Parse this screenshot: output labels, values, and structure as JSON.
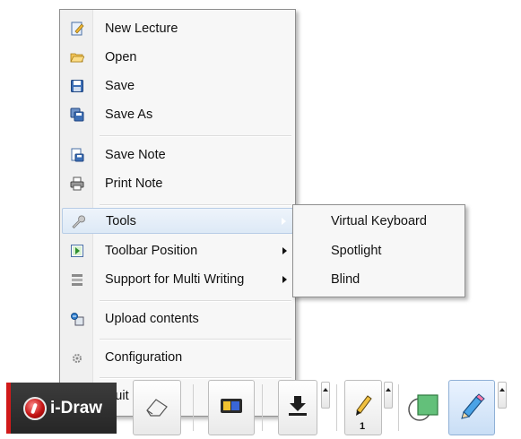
{
  "menu": {
    "items": [
      {
        "label": "New Lecture",
        "icon": "new-lecture-icon"
      },
      {
        "label": "Open",
        "icon": "open-folder-icon"
      },
      {
        "label": "Save",
        "icon": "save-disk-icon"
      },
      {
        "label": "Save As",
        "icon": "save-as-icon"
      },
      {
        "label": "Save Note",
        "icon": "save-note-icon"
      },
      {
        "label": "Print Note",
        "icon": "printer-icon"
      },
      {
        "label": "Tools",
        "icon": "wrench-icon",
        "highlighted": true
      },
      {
        "label": "Toolbar Position",
        "icon": "toolbar-position-icon"
      },
      {
        "label": "Support for Multi Writing",
        "icon": "multi-writing-icon"
      },
      {
        "label": "Upload contents",
        "icon": "upload-icon"
      },
      {
        "label": "Configuration",
        "icon": "gear-icon"
      },
      {
        "label": "Quit i-Pro",
        "icon": "exit-door-icon"
      }
    ]
  },
  "submenu": {
    "items": [
      {
        "label": "Virtual Keyboard"
      },
      {
        "label": "Spotlight"
      },
      {
        "label": "Blind"
      }
    ]
  },
  "toolbar": {
    "brand": "i-Draw",
    "pen_width": "1",
    "accent_red": "#d11a1a",
    "buttons": [
      "eraser-icon",
      "color-palette-icon",
      "download-icon",
      "pen-icon",
      "shape-icon",
      "pencil-icon"
    ]
  }
}
